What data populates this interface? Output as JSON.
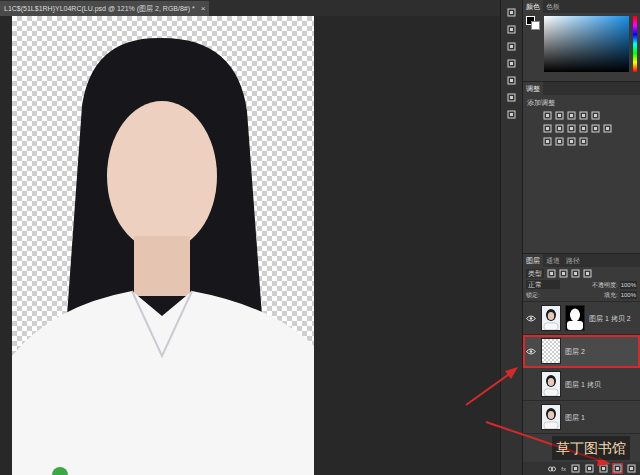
{
  "window": {
    "title": "L1C$(51L$1RH}YL04RC(LU.psd @ 121% (图层 2, RGB/8#) *",
    "close": "×"
  },
  "color_panel": {
    "tabs": [
      {
        "label": "颜色",
        "selected": true
      },
      {
        "label": "色板",
        "selected": false
      }
    ]
  },
  "adjustments_panel": {
    "title": "调整",
    "add_label": "添加调整"
  },
  "layers_panel": {
    "tabs": [
      {
        "label": "图层",
        "selected": true
      },
      {
        "label": "通道",
        "selected": false
      },
      {
        "label": "路径",
        "selected": false
      }
    ],
    "filter": "类型",
    "blend_mode": "正常",
    "opacity_label": "不透明度:",
    "opacity": "100%",
    "lock_label": "锁定:",
    "fill_label": "填充:",
    "fill": "100%",
    "layers": [
      {
        "name": "图层 1 拷贝 2",
        "visible": true,
        "selected": false,
        "has_mask": true,
        "kind": "photo"
      },
      {
        "name": "图层 2",
        "visible": true,
        "selected": true,
        "has_mask": false,
        "kind": "transparent"
      },
      {
        "name": "图层 1 拷贝",
        "visible": false,
        "selected": false,
        "has_mask": false,
        "kind": "photo"
      },
      {
        "name": "图层 1",
        "visible": false,
        "selected": false,
        "has_mask": false,
        "kind": "photo"
      }
    ],
    "fx_label": "fx"
  },
  "watermark": "草丁图书馆"
}
